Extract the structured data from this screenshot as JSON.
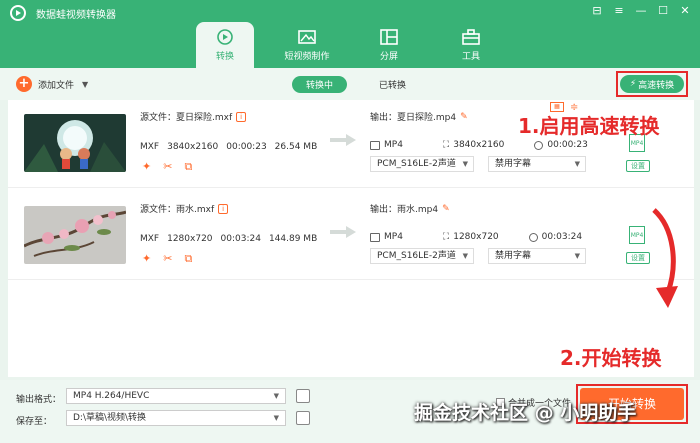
{
  "app": {
    "title": "数据蛙视频转换器"
  },
  "window_controls": [
    "⊟",
    "≡",
    "—",
    "☐",
    "✕"
  ],
  "tabs": [
    {
      "label": "转换",
      "active": true
    },
    {
      "label": "短视频制作",
      "active": false
    },
    {
      "label": "分屏",
      "active": false
    },
    {
      "label": "工具",
      "active": false
    }
  ],
  "toolbar": {
    "add_file": "添加文件",
    "status_tabs": [
      {
        "label": "转换中",
        "active": true
      },
      {
        "label": "已转换",
        "active": false
      }
    ],
    "fast_convert": "高速转换"
  },
  "files": [
    {
      "source_label": "源文件：夏日探险.mxf",
      "src_format": "MXF",
      "src_resolution": "3840x2160",
      "src_duration": "00:00:23",
      "src_size": "26.54 MB",
      "output_label": "输出：夏日探险.mp4",
      "out_format": "MP4",
      "out_resolution": "3840x2160",
      "out_duration": "00:00:23",
      "audio": "PCM_S16LE-2声道",
      "subtitle": "禁用字幕",
      "settings": "设置",
      "format_badge": "MP4"
    },
    {
      "source_label": "源文件：雨水.mxf",
      "src_format": "MXF",
      "src_resolution": "1280x720",
      "src_duration": "00:03:24",
      "src_size": "144.89 MB",
      "output_label": "输出：雨水.mp4",
      "out_format": "MP4",
      "out_resolution": "1280x720",
      "out_duration": "00:03:24",
      "audio": "PCM_S16LE-2声道",
      "subtitle": "禁用字幕",
      "settings": "设置",
      "format_badge": "MP4"
    }
  ],
  "annotations": {
    "step1": "1.启用高速转换",
    "step2": "2.开始转换"
  },
  "bottom": {
    "output_format_label": "输出格式：",
    "output_format_value": "MP4 H.264/HEVC",
    "save_to_label": "保存至：",
    "save_to_value": "D:\\草稿\\视频\\转换",
    "merge_label": "合并成一个文件",
    "start_button": "开始转换"
  },
  "watermark": "掘金技术社区 @ 小明助手",
  "colors": {
    "brand": "#38b276",
    "accent": "#ff6a2d",
    "annotation": "#e52a2a"
  }
}
